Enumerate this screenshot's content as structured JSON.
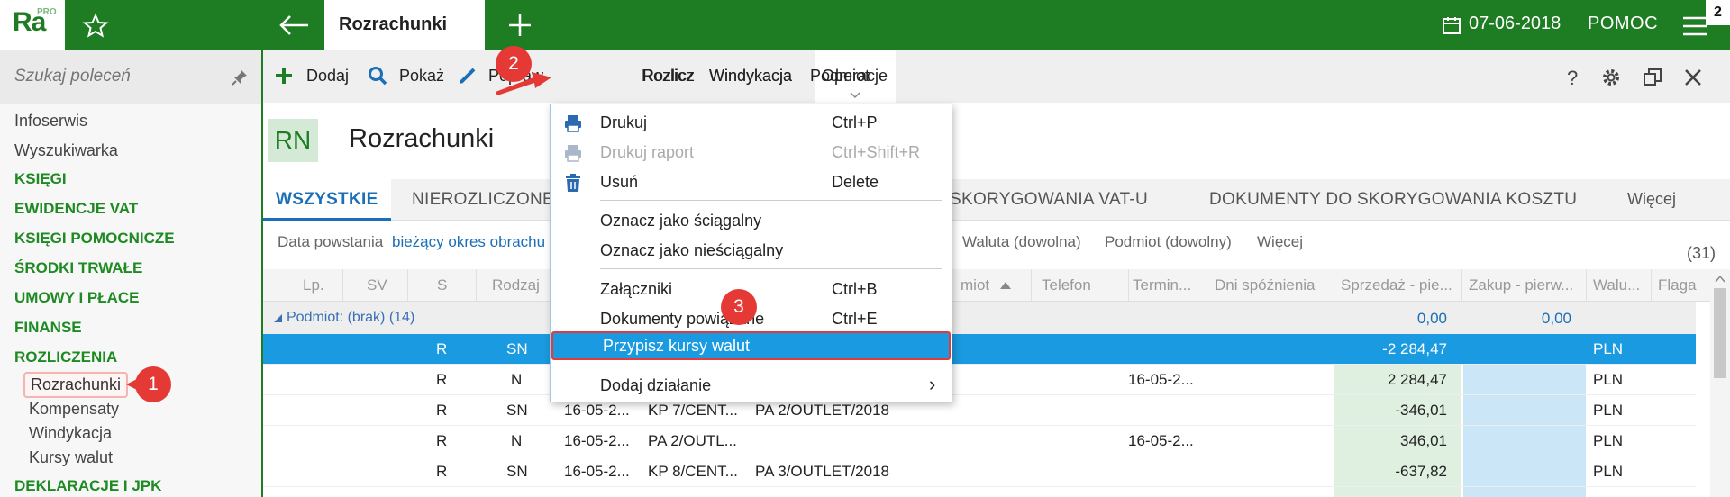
{
  "topbar": {
    "logo_text": "Ra",
    "logo_sup": "PRO",
    "active_tab": "Rozrachunki",
    "date": "07-06-2018",
    "help": "POMOC",
    "badge": "2"
  },
  "sidebar": {
    "search_placeholder": "Szukaj poleceń",
    "items": [
      {
        "label": "Infoserwis"
      },
      {
        "label": "Wyszukiwarka"
      },
      {
        "label": "KSIĘGI"
      },
      {
        "label": "EWIDENCJE VAT"
      },
      {
        "label": "KSIĘGI POMOCNICZE"
      },
      {
        "label": "ŚRODKI TRWAŁE"
      },
      {
        "label": "UMOWY I PŁACE"
      },
      {
        "label": "FINANSE"
      },
      {
        "label": "ROZLICZENIA"
      },
      {
        "label": "Rozrachunki"
      },
      {
        "label": "Kompensaty"
      },
      {
        "label": "Windykacja"
      },
      {
        "label": "Kursy walut"
      },
      {
        "label": "DEKLARACJE I JPK"
      }
    ]
  },
  "toolbar": {
    "add": "Dodaj",
    "show": "Pokaż",
    "edit": "Popraw",
    "operations": "Operacje",
    "settle": "Rozlicz",
    "collection": "Windykacja",
    "entity": "Podmiot"
  },
  "header": {
    "badge": "RN",
    "title": "Rozrachunki"
  },
  "tabs": [
    "WSZYSTKIE",
    "NIEROZLICZONE",
    "SKORYGOWANIA VAT-U",
    "DOKUMENTY DO SKORYGOWANIA KOSZTU",
    "Więcej"
  ],
  "filters": {
    "date_label": "Data powstania",
    "date_value": "bieżący okres obrachu",
    "currency": "Waluta (dowolna)",
    "entity": "Podmiot (dowolny)",
    "more": "Więcej",
    "count": "(31)"
  },
  "grid": {
    "columns": [
      "Lp.",
      "SV",
      "S",
      "Rodzaj",
      "miot",
      "Telefon",
      "Termin...",
      "Dni spóźnienia",
      "Sprzedaż - pie...",
      "Zakup - pierw...",
      "Walu...",
      "Flaga"
    ],
    "group": {
      "label": "Podmiot: (brak) (14)",
      "sprzedaz": "0,00",
      "zakup": "0,00"
    },
    "rows": [
      {
        "s": "R",
        "rodzaj": "SN",
        "data": "",
        "numer": "",
        "podmiot": "",
        "termin": "",
        "sprzedaz": "-2 284,47",
        "waluta": "PLN"
      },
      {
        "s": "R",
        "rodzaj": "N",
        "data": "",
        "numer": "",
        "podmiot": "",
        "termin": "16-05-2...",
        "sprzedaz": "2 284,47",
        "waluta": "PLN"
      },
      {
        "s": "R",
        "rodzaj": "SN",
        "data": "16-05-2...",
        "numer": "KP 7/CENT...",
        "podmiot": "PA 2/OUTLET/2018",
        "termin": "",
        "sprzedaz": "-346,01",
        "waluta": "PLN"
      },
      {
        "s": "R",
        "rodzaj": "N",
        "data": "16-05-2...",
        "numer": "PA 2/OUTL...",
        "podmiot": "",
        "termin": "16-05-2...",
        "sprzedaz": "346,01",
        "waluta": "PLN"
      },
      {
        "s": "R",
        "rodzaj": "SN",
        "data": "16-05-2...",
        "numer": "KP 8/CENT...",
        "podmiot": "PA 3/OUTLET/2018",
        "termin": "",
        "sprzedaz": "-637,82",
        "waluta": "PLN"
      }
    ]
  },
  "menu": {
    "items": [
      {
        "label": "Drukuj",
        "shortcut": "Ctrl+P"
      },
      {
        "label": "Drukuj raport",
        "shortcut": "Ctrl+Shift+R"
      },
      {
        "label": "Usuń",
        "shortcut": "Delete"
      },
      {
        "label": "Oznacz jako ściągalny",
        "shortcut": ""
      },
      {
        "label": "Oznacz jako nieściągalny",
        "shortcut": ""
      },
      {
        "label": "Załączniki",
        "shortcut": "Ctrl+B"
      },
      {
        "label": "Dokumenty powiązane",
        "shortcut": "Ctrl+E"
      },
      {
        "label": "Przypisz kursy walut",
        "shortcut": ""
      },
      {
        "label": "Dodaj działanie",
        "shortcut": ""
      }
    ],
    "submenu_arrow": "›"
  },
  "markers": [
    "1",
    "2",
    "3"
  ],
  "colors": {
    "brand_green": "#1e7d22",
    "selection_blue": "#1a9ae0",
    "marker_red": "#e53935"
  }
}
